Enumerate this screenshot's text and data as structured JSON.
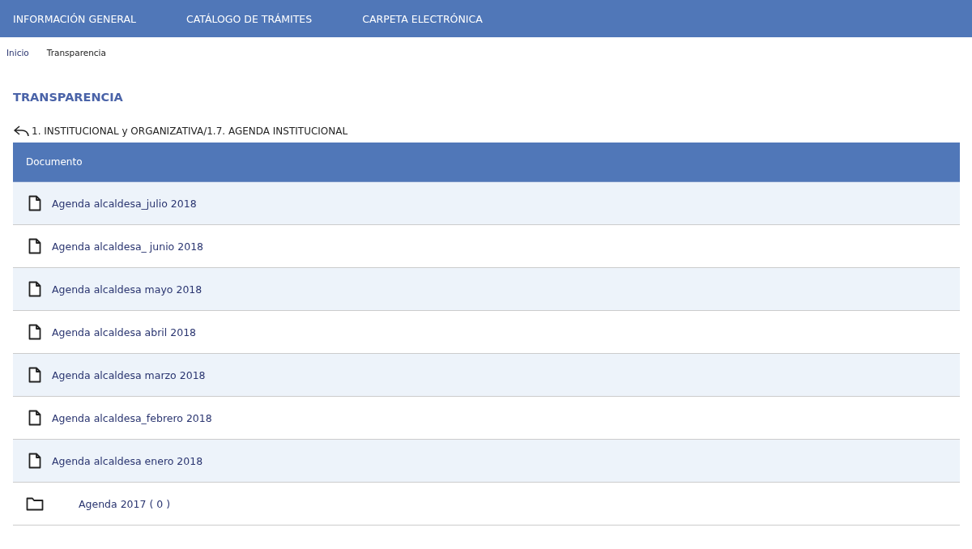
{
  "nav": [
    {
      "label": "INFORMACIÓN GENERAL"
    },
    {
      "label": "CATÁLOGO DE TRÁMITES"
    },
    {
      "label": "CARPETA ELECTRÓNICA"
    }
  ],
  "breadcrumb": [
    {
      "label": "Inicio"
    },
    {
      "label": "Transparencia"
    }
  ],
  "title": "TRANSPARENCIA",
  "path": "1. INSTITUCIONAL y ORGANIZATIVA/1.7. AGENDA INSTITUCIONAL",
  "table": {
    "columns": [
      "Documento"
    ],
    "rows": [
      {
        "kind": "document",
        "name": "Agenda alcaldesa_julio 2018"
      },
      {
        "kind": "document",
        "name": "Agenda alcaldesa_ junio 2018"
      },
      {
        "kind": "document",
        "name": "Agenda alcaldesa mayo 2018"
      },
      {
        "kind": "document",
        "name": "Agenda alcaldesa abril 2018"
      },
      {
        "kind": "document",
        "name": "Agenda alcaldesa marzo 2018"
      },
      {
        "kind": "document",
        "name": "Agenda alcaldesa_febrero 2018"
      },
      {
        "kind": "document",
        "name": "Agenda alcaldesa enero 2018"
      },
      {
        "kind": "folder",
        "name": "Agenda 2017 ( 0 )"
      }
    ]
  }
}
